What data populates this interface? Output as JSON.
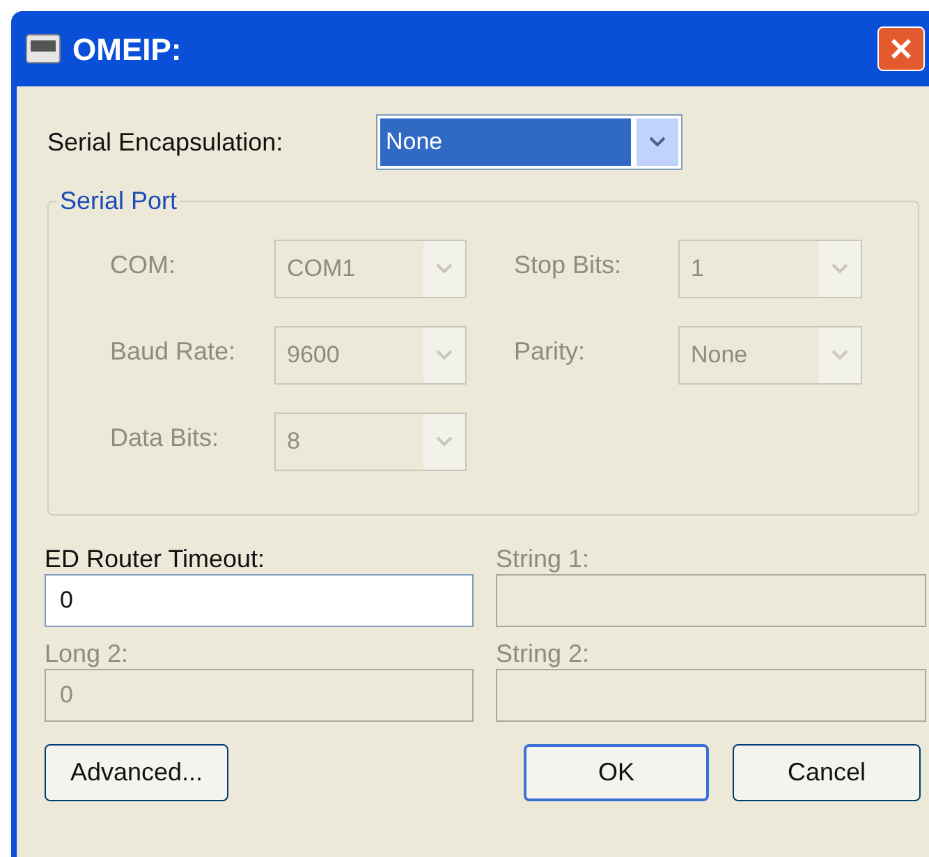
{
  "window": {
    "title": "OMEIP:"
  },
  "encapsulation": {
    "label": "Serial Encapsulation:",
    "value": "None",
    "disabled": false,
    "selected": true
  },
  "serial_port": {
    "title": "Serial Port",
    "disabled": true,
    "combos": [
      {
        "label": "COM:",
        "value": "COM1"
      },
      {
        "label": "Stop Bits:",
        "value": "1"
      },
      {
        "label": "Baud Rate:",
        "value": "9600"
      },
      {
        "label": "Parity:",
        "value": "None"
      },
      {
        "label": "Data Bits:",
        "value": "8"
      }
    ]
  },
  "fields": [
    {
      "label": "ED Router Timeout:",
      "value": "0",
      "disabled": false
    },
    {
      "label": "String 1:",
      "disabled": true
    },
    {
      "label": "Long 2:",
      "value": "0",
      "disabled": true
    },
    {
      "label": "String 2:",
      "disabled": true
    }
  ],
  "buttons": [
    {
      "label": "Advanced...",
      "default": false
    },
    {
      "label": "OK",
      "default": true
    },
    {
      "label": "Cancel",
      "default": false
    }
  ]
}
